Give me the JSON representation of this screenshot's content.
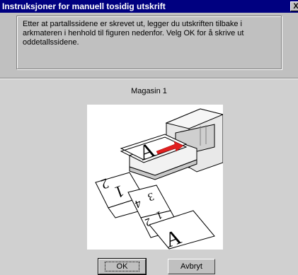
{
  "window": {
    "title": "Instruksjoner for manuell tosidig utskrift",
    "close_label": "X"
  },
  "instruction": {
    "text": "Etter at partallssidene er skrevet ut, legger du utskriften tilbake i\narkmateren i henhold til figuren nedenfor. Velg OK for å skrive ut\noddetallssidene."
  },
  "figure": {
    "tray_label": "Magasin 1",
    "page_labels": [
      "A",
      "1",
      "2",
      "3",
      "4",
      "1",
      "2",
      "A"
    ],
    "arrow_color": "#e02020"
  },
  "buttons": {
    "ok_label": "OK",
    "cancel_label": "Avbryt"
  }
}
